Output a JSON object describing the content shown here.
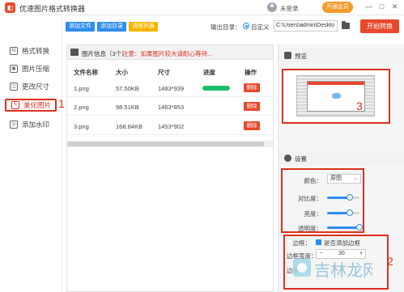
{
  "app": {
    "title": "优速图片格式转换器",
    "logo_text": "◧",
    "login_text": "未登录",
    "vip_label": "开通会员",
    "min_icon": "—",
    "max_icon": "□",
    "close_icon": "✕"
  },
  "sidebar": {
    "items": [
      {
        "label": "格式转换",
        "icon": "format-convert-icon",
        "glyph": "N"
      },
      {
        "label": "图片压缩",
        "icon": "compress-icon",
        "glyph": "▣"
      },
      {
        "label": "更改尺寸",
        "icon": "resize-icon",
        "glyph": "◫"
      },
      {
        "label": "美化图片",
        "icon": "beautify-icon",
        "glyph": "✎"
      },
      {
        "label": "添加水印",
        "icon": "watermark-icon",
        "glyph": "◎"
      }
    ],
    "active_index": 3
  },
  "annotations": {
    "one": "1",
    "two": "2",
    "three": "3"
  },
  "toolbar": {
    "add_file": "添加文件",
    "add_folder": "添加目录",
    "clear_list": "清除列表",
    "output_label": "输出目录：",
    "custom_label": "自定义",
    "output_path": "C:\\Users\\admin\\Deskto",
    "start_label": "开始转换",
    "colors": {
      "blue": "#2d8cf0",
      "yellow": "#f7b500",
      "red": "#e8482c"
    }
  },
  "file_list": {
    "header_title": "图片信息（3个）",
    "header_note": "注意：如果图片较大请耐心等待...",
    "columns": [
      "文件名称",
      "大小",
      "尺寸",
      "进度",
      "操作"
    ],
    "rows": [
      {
        "name": "1.png",
        "size": "57.50KB",
        "dims": "1483*939",
        "progress": 1.0,
        "action": "删除"
      },
      {
        "name": "2.png",
        "size": "98.51KB",
        "dims": "1463*853",
        "progress": 0.0,
        "action": "删除"
      },
      {
        "name": "3.png",
        "size": "168.84KB",
        "dims": "1453*902",
        "progress": 0.0,
        "action": "删除"
      }
    ]
  },
  "preview": {
    "title": "预览"
  },
  "settings": {
    "title": "设置",
    "color_label": "颜色：",
    "color_value": "原图",
    "contrast_label": "对比度：",
    "contrast_value": 0.7,
    "brightness_label": "亮度：",
    "brightness_value": 0.7,
    "transparency_label": "透明度：",
    "transparency_value": 1.0,
    "border_label": "边框：",
    "border_check_label": "是否添加边框",
    "border_width_label": "边框宽度：",
    "border_width_value": "30",
    "border_color_label": "边框"
  },
  "watermark_text": "吉林龙网"
}
